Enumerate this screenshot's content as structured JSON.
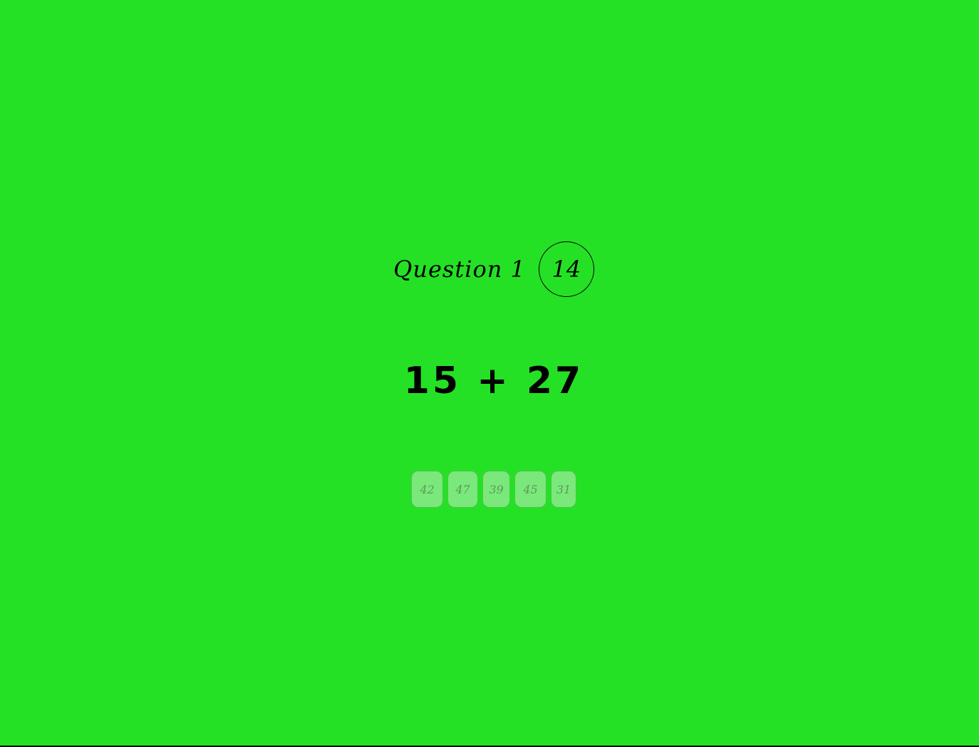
{
  "header": {
    "question_label": "Question 1",
    "timer": "14"
  },
  "problem": {
    "text": "15 + 27"
  },
  "answers": [
    {
      "label": "42"
    },
    {
      "label": "47"
    },
    {
      "label": "39"
    },
    {
      "label": "45"
    },
    {
      "label": "31"
    }
  ],
  "colors": {
    "background": "#25e125",
    "answer_fill": "#7be87b",
    "answer_border": "#4cc44c",
    "answer_text": "#5a9a5a"
  }
}
